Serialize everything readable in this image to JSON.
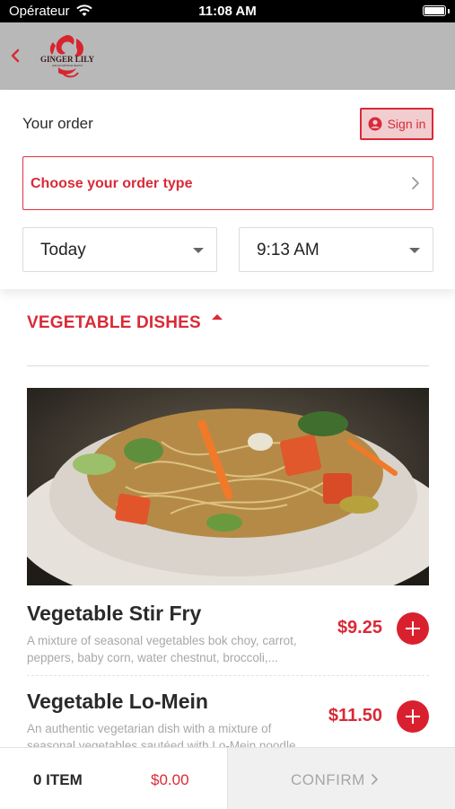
{
  "status_bar": {
    "carrier": "Opérateur",
    "time": "11:08 AM"
  },
  "header": {
    "logo_text": "GINGER LILY",
    "logo_subtext": "ASIAN RESTAURANT"
  },
  "order": {
    "title": "Your order",
    "signin_label": "Sign in",
    "order_type_label": "Choose your order type",
    "day_value": "Today",
    "time_value": "9:13 AM"
  },
  "menu": {
    "section_title": "VEGETABLE DISHES",
    "items": [
      {
        "name": "Vegetable Stir Fry",
        "description": "A mixture of seasonal vegetables bok choy, carrot, peppers, baby corn, water chestnut, broccoli,...",
        "price": "$9.25"
      },
      {
        "name": "Vegetable Lo-Mein",
        "description": "An authentic vegetarian dish with a mixture of seasonal vegetables sautéed with Lo-Mein noodle",
        "price": "$11.50"
      }
    ]
  },
  "cart": {
    "item_count": "0 ITEM",
    "total": "$0.00",
    "confirm_label": "CONFIRM"
  },
  "colors": {
    "accent": "#d92a37",
    "header_bg": "#b8b8b8"
  },
  "icons": [
    "wifi-icon",
    "battery-icon",
    "back-chevron-icon",
    "user-circle-icon",
    "chevron-right-icon",
    "caret-down-icon",
    "caret-up-icon",
    "plus-icon"
  ]
}
